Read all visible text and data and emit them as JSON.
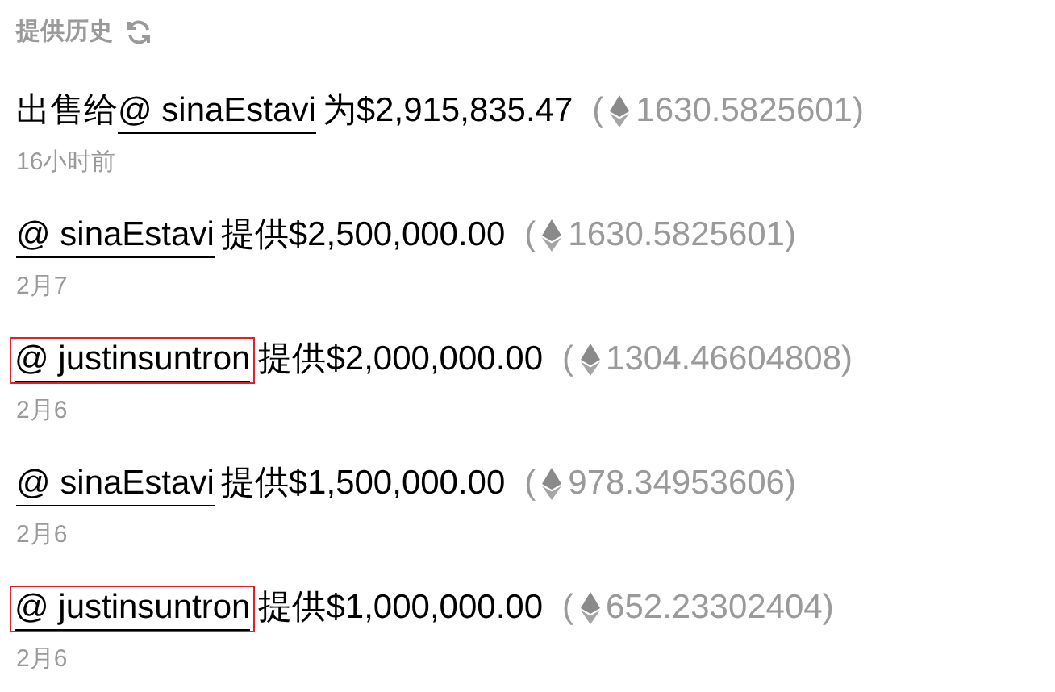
{
  "header": {
    "title": "提供历史"
  },
  "offers": [
    {
      "prefix": "出售给",
      "user": "@ sinaEstavi",
      "highlighted": false,
      "text": "为$2,915,835.47",
      "eth_open": "(",
      "eth": "1630.5825601)",
      "time": "16小时前"
    },
    {
      "user": "@ sinaEstavi",
      "highlighted": false,
      "text": "提供$2,500,000.00",
      "eth_open": "(",
      "eth": "1630.5825601)",
      "time": "2月7"
    },
    {
      "user": "@ justinsuntron",
      "highlighted": true,
      "text": "提供$2,000,000.00",
      "eth_open": "(",
      "eth": "1304.46604808)",
      "time": "2月6"
    },
    {
      "user": "@ sinaEstavi",
      "highlighted": false,
      "text": "提供$1,500,000.00",
      "eth_open": "(",
      "eth": "978.34953606)",
      "time": "2月6"
    },
    {
      "user": "@ justinsuntron",
      "highlighted": true,
      "text": "提供$1,000,000.00",
      "eth_open": "(",
      "eth": "652.23302404)",
      "time": "2月6"
    }
  ]
}
